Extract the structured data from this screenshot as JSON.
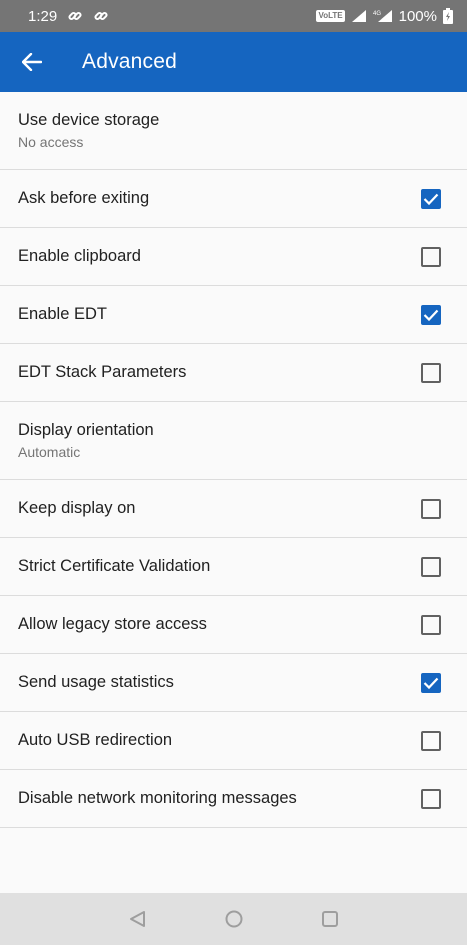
{
  "status_bar": {
    "time": "1:29",
    "network_badge": "VoLTE",
    "battery": "100%",
    "icons": [
      "link-icon",
      "link-icon",
      "signal-icon",
      "4g-signal-icon",
      "battery-icon"
    ]
  },
  "app_bar": {
    "title": "Advanced",
    "back_icon": "arrow-back-icon",
    "color": "#1565c0"
  },
  "settings": [
    {
      "title": "Use device storage",
      "subtitle": "No access",
      "checkbox": null
    },
    {
      "title": "Ask before exiting",
      "subtitle": null,
      "checkbox": true
    },
    {
      "title": "Enable clipboard",
      "subtitle": null,
      "checkbox": false
    },
    {
      "title": "Enable EDT",
      "subtitle": null,
      "checkbox": true
    },
    {
      "title": "EDT Stack Parameters",
      "subtitle": null,
      "checkbox": false
    },
    {
      "title": "Display orientation",
      "subtitle": "Automatic",
      "checkbox": null
    },
    {
      "title": "Keep display on",
      "subtitle": null,
      "checkbox": false
    },
    {
      "title": "Strict Certificate Validation",
      "subtitle": null,
      "checkbox": false
    },
    {
      "title": "Allow legacy store access",
      "subtitle": null,
      "checkbox": false
    },
    {
      "title": "Send usage statistics",
      "subtitle": null,
      "checkbox": true
    },
    {
      "title": "Auto USB redirection",
      "subtitle": null,
      "checkbox": false
    },
    {
      "title": "Disable network monitoring messages",
      "subtitle": null,
      "checkbox": false
    }
  ],
  "nav_bar": {
    "icons": [
      "back-triangle-icon",
      "home-circle-icon",
      "recents-square-icon"
    ]
  }
}
